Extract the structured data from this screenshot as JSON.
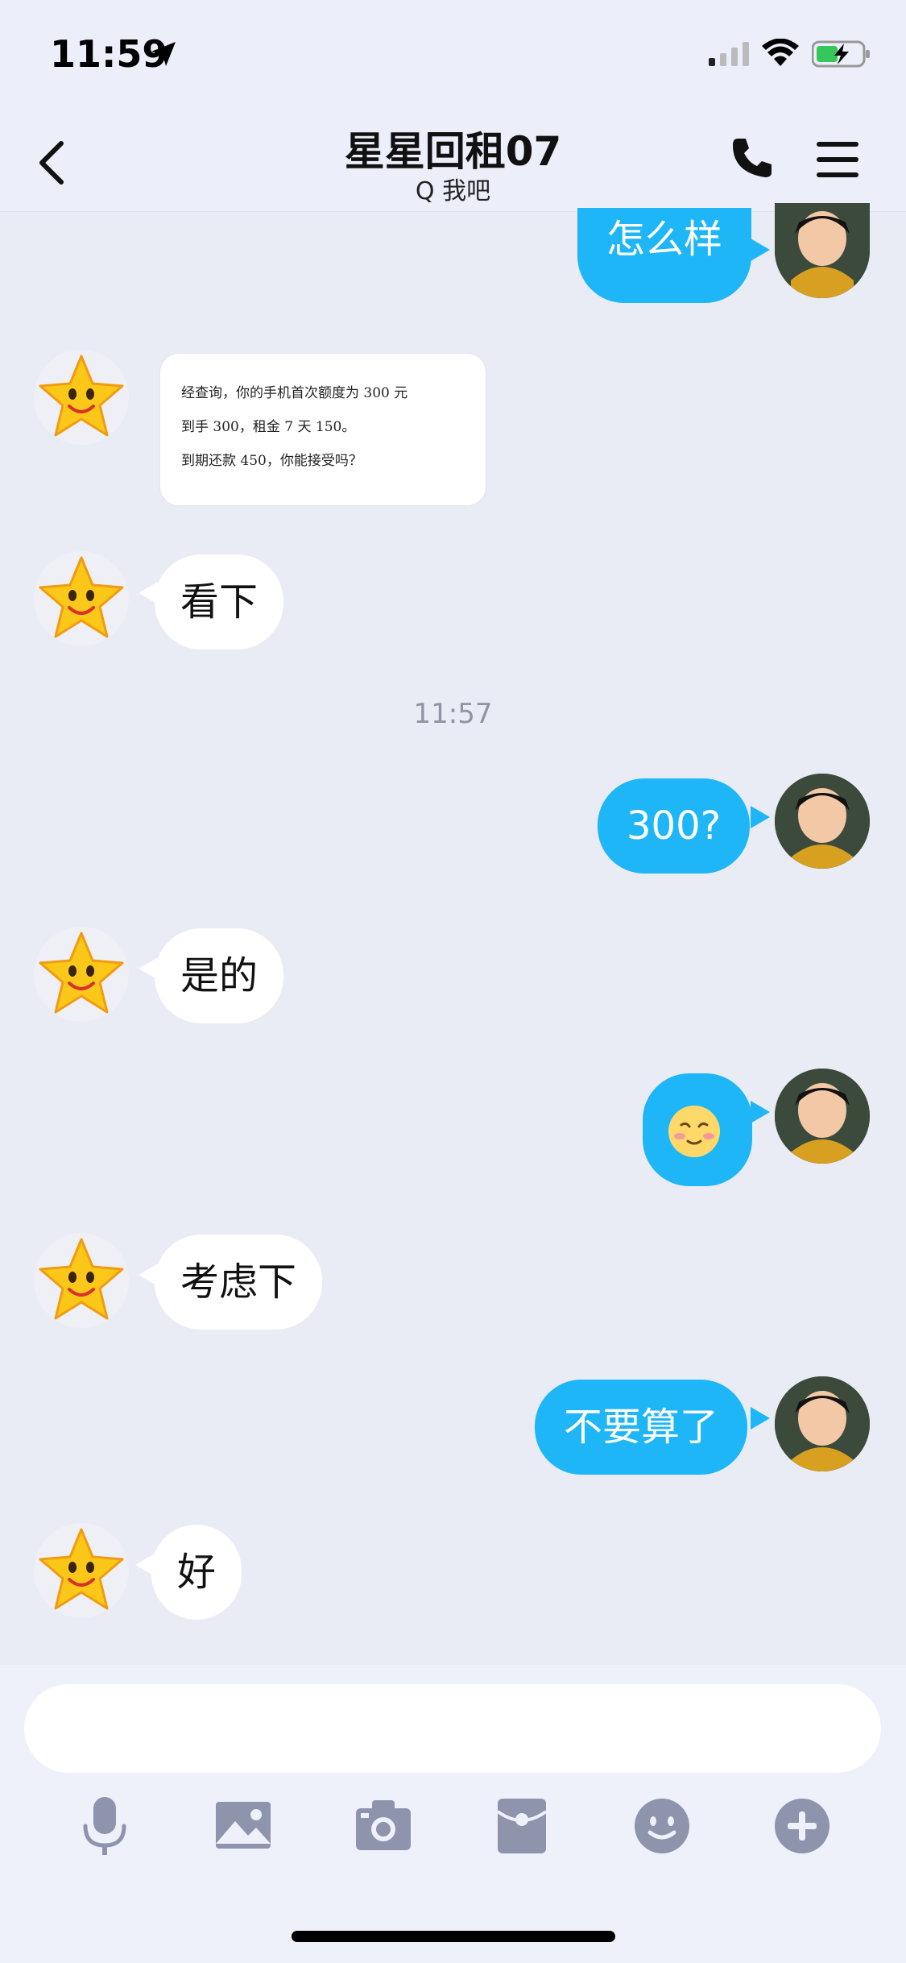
{
  "status_bar": {
    "time": "11:59"
  },
  "header": {
    "title": "星星回租07",
    "subtitle": "Q 我吧"
  },
  "timestamp": "11:57",
  "messages": {
    "m1": "怎么样",
    "image": {
      "line1": "经查询，你的手机首次额度为 300 元",
      "line2": "到手 300，租金 7 天 150。",
      "line3": "到期还款 450，你能接受吗？"
    },
    "m3": "看下",
    "m4": "300?",
    "m5": "是的",
    "m7": "考虑下",
    "m8": "不要算了",
    "m9": "好"
  },
  "input": {
    "placeholder": ""
  },
  "toolbar": {
    "icons": [
      "microphone-icon",
      "image-icon",
      "camera-icon",
      "red-packet-icon",
      "emoji-icon",
      "plus-icon"
    ]
  },
  "colors": {
    "bubble_out": "#1fb6f7",
    "bubble_in": "#ffffff",
    "background": "#e9ebf5",
    "toolbar_icon": "#8f94ad"
  }
}
